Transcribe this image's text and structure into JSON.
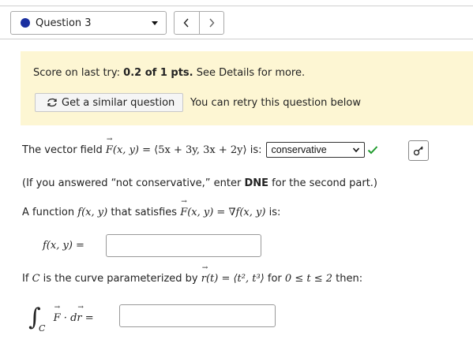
{
  "nav": {
    "question_label": "Question 3",
    "prev_icon": "chevron-left-icon",
    "next_icon": "chevron-right-icon",
    "status_dot_color": "#1a2fa0"
  },
  "score": {
    "prefix": "Score on last try: ",
    "value": "0.2 of 1 pts.",
    "suffix": " See Details for more.",
    "similar_button": "Get a similar question",
    "retry_text": "You can retry this question below",
    "background": "#fdf6d3"
  },
  "question": {
    "intro": "The vector field",
    "field_lhs": "F(x, y)",
    "field_rhs": "= ⟨5x + 3y, 3x + 2y⟩",
    "is_label": "is:",
    "answer_selected": "conservative",
    "answer_correct": true,
    "note": "(If you answered “not conservative,” enter",
    "note_bold": "DNE",
    "note_tail": "for the second part.)",
    "function_intro": "A function",
    "function_fxy": "f(x, y)",
    "function_mid": "that satisfies",
    "function_eq": "F(x, y) = ∇f(x, y)",
    "function_tail": "is:",
    "f_label": "f(x, y) =",
    "f_value": "",
    "curve_intro": "If",
    "curve_C": "C",
    "curve_mid": "is the curve parameterized by",
    "curve_r": "r(t) = ⟨t², t³⟩",
    "curve_for": "for",
    "curve_range": "0 ≤ t ≤ 2",
    "curve_tail": "then:",
    "integral_sub": "C",
    "integral_body": "F · dr =",
    "integral_value": ""
  }
}
